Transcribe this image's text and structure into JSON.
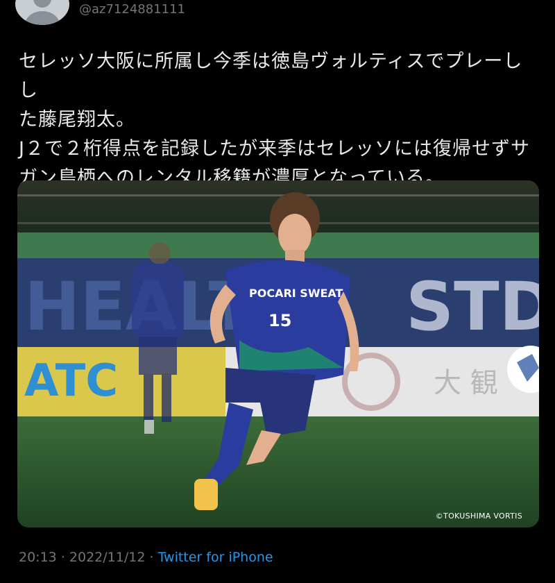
{
  "tweet": {
    "handle": "@az7124881111",
    "text_lines": [
      "セレッソ大阪に所属し今季は徳島ヴォルティスでプレーしし",
      "た藤尾翔太。",
      "J２で２桁得点を記録したが来季はセレッソには復帰せずサ",
      "ガン鳥栖へのレンタル移籍が濃厚となっている。"
    ],
    "media": {
      "credit": "©TOKUSHIMA VORTIS",
      "jersey_text": "POCARI SWEAT",
      "jersey_number": "15"
    },
    "time": "20:13",
    "separator": "·",
    "date": "2022/11/12",
    "source": "Twitter for iPhone"
  },
  "colors": {
    "background": "#000000",
    "text": "#e7e9ea",
    "muted": "#71767b",
    "link": "#1d9bf0"
  }
}
